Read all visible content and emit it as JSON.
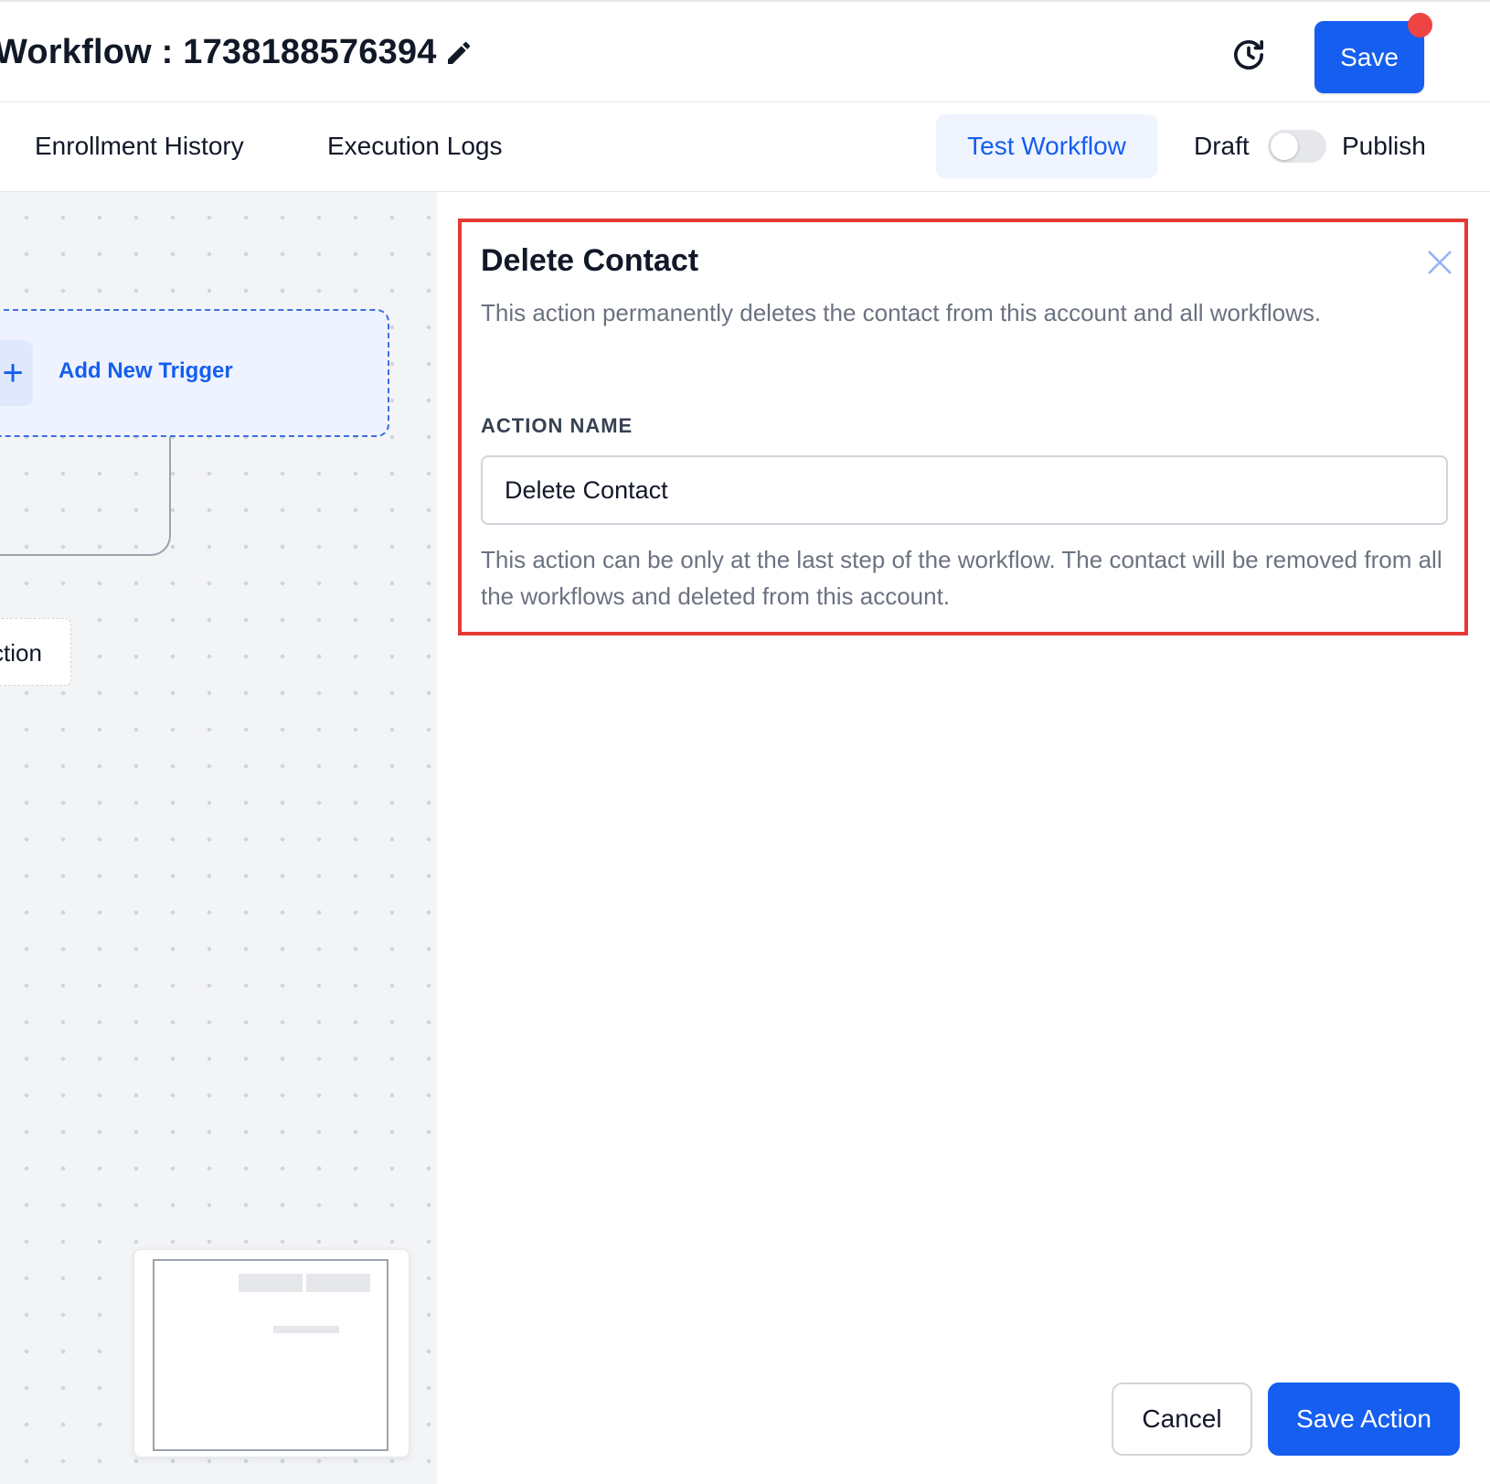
{
  "header": {
    "title": "Workflow : 1738188576394",
    "edit_icon": "pencil-icon",
    "history_icon": "history-clock-icon",
    "save_label": "Save",
    "unsaved_indicator_color": "#ef4444"
  },
  "subheader": {
    "tabs": [
      {
        "label": "Enrollment History"
      },
      {
        "label": "Execution Logs"
      }
    ],
    "test_workflow_label": "Test Workflow",
    "draft_label": "Draft",
    "publish_label": "Publish",
    "publish_toggle_on": false
  },
  "canvas": {
    "add_trigger_label": "Add New Trigger",
    "action_node_label": "ction"
  },
  "panel": {
    "title": "Delete Contact",
    "description": "This action permanently deletes the contact from this account and all workflows.",
    "field_label": "ACTION NAME",
    "field_value": "Delete Contact",
    "help_text": "This action can be only at the last step of the workflow. The contact will be removed from all the workflows and deleted from this account.",
    "cancel_label": "Cancel",
    "save_action_label": "Save Action"
  },
  "colors": {
    "accent": "#155eef",
    "accent_light": "#eff4ff",
    "highlight_border": "#e53935",
    "muted_text": "#6b7280"
  }
}
